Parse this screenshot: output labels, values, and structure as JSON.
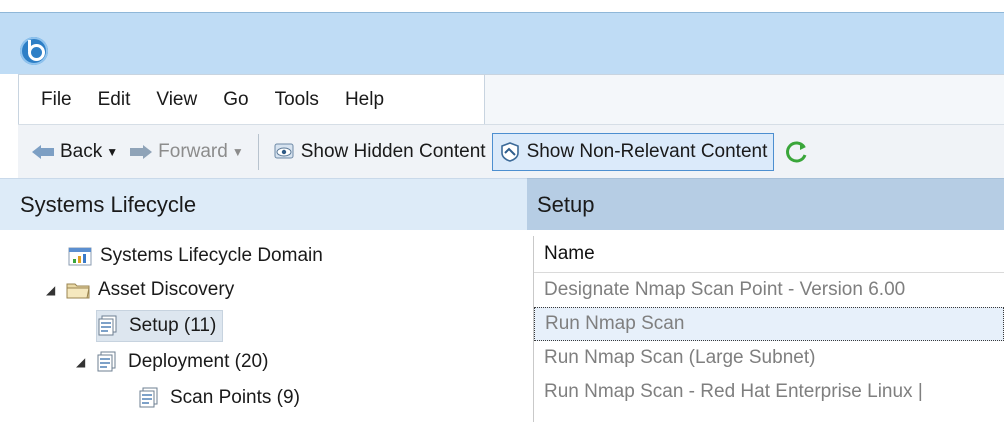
{
  "menu": {
    "items": [
      "File",
      "Edit",
      "View",
      "Go",
      "Tools",
      "Help"
    ]
  },
  "toolbar": {
    "back_label": "Back",
    "forward_label": "Forward",
    "show_hidden_label": "Show Hidden Content",
    "show_nonrelevant_label": "Show Non-Relevant Content",
    "icons": [
      "arrow-left-icon",
      "arrow-right-icon",
      "eye-icon",
      "shield-icon",
      "refresh-icon"
    ]
  },
  "left_pane": {
    "title": "Systems Lifecycle",
    "tree": {
      "domain": "Systems Lifecycle Domain",
      "asset_discovery": "Asset Discovery",
      "setup": "Setup (11)",
      "deployment": "Deployment (20)",
      "scan_points": "Scan Points (9)"
    }
  },
  "right_pane": {
    "title": "Setup",
    "column_name": "Name",
    "rows": [
      "Designate Nmap Scan Point - Version 6.00",
      "Run Nmap Scan",
      "Run Nmap Scan (Large Subnet)",
      "Run Nmap Scan - Red Hat Enterprise Linux |"
    ]
  },
  "colors": {
    "titlebar": "#bfdcf5",
    "pane_header_left": "#ddebf8",
    "pane_header_right": "#b6cde4",
    "accent": "#4d8fd0"
  }
}
